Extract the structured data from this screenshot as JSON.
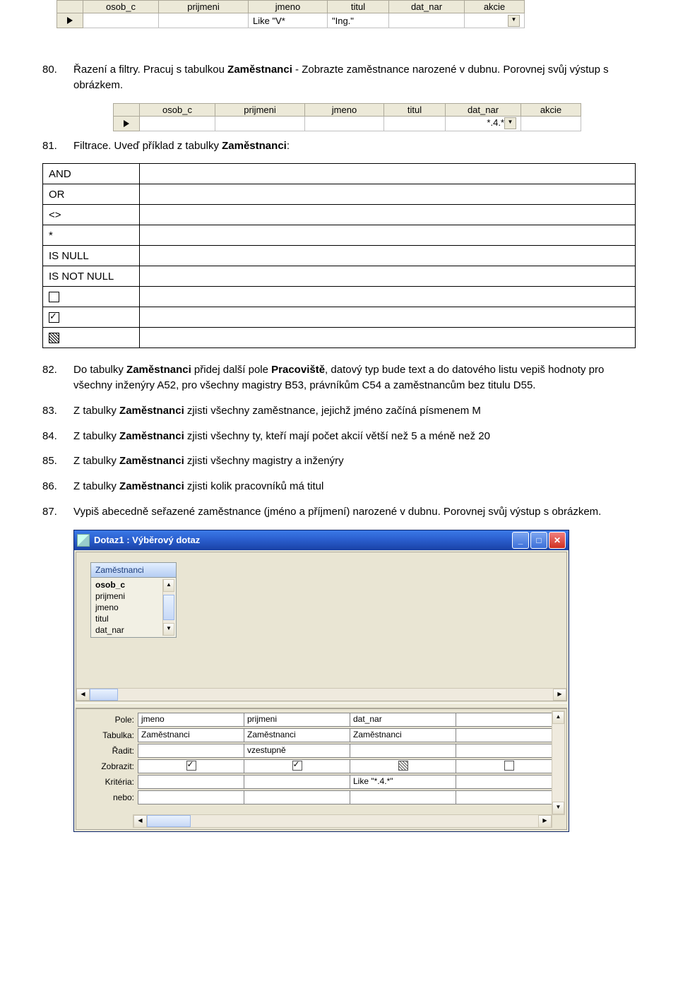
{
  "grid_headers": [
    "osob_c",
    "prijmeni",
    "jmeno",
    "titul",
    "dat_nar",
    "akcie"
  ],
  "grid1_row": [
    "",
    "",
    "Like \"V*",
    "\"Ing.\"",
    "",
    ""
  ],
  "grid2_row": [
    "",
    "",
    "",
    "",
    "*.4.*",
    ""
  ],
  "tasks": {
    "t80_num": "80.",
    "t80_a": "Řazení a filtry. Pracuj s tabulkou ",
    "t80_b": "Zaměstnanci",
    "t80_c": " - Zobrazte zaměstnance narozené v dubnu. Porovnej svůj výstup s obrázkem.",
    "t81_num": "81.",
    "t81_a": "Filtrace. Uveď příklad z tabulky ",
    "t81_b": "Zaměstnanci",
    "t81_c": ":",
    "t82_num": "82.",
    "t82_a": "Do tabulky ",
    "t82_b": "Zaměstnanci",
    "t82_c": " přidej další pole ",
    "t82_d": "Pracoviště",
    "t82_e": ", datový typ bude text a do datového listu vepiš hodnoty pro všechny inženýry A52, pro všechny magistry B53, právníkům C54 a zaměstnancům bez titulu D55.",
    "t83_num": "83.",
    "t83_a": "Z tabulky ",
    "t83_b": "Zaměstnanci",
    "t83_c": " zjisti všechny zaměstnance, jejichž jméno začíná písmenem M",
    "t84_num": "84.",
    "t84_a": "Z tabulky ",
    "t84_b": "Zaměstnanci",
    "t84_c": " zjisti všechny ty, kteří mají počet akcií větší než 5 a méně než 20",
    "t85_num": "85.",
    "t85_a": "Z tabulky ",
    "t85_b": "Zaměstnanci",
    "t85_c": " zjisti všechny magistry a inženýry",
    "t86_num": "86.",
    "t86_a": "Z tabulky ",
    "t86_b": "Zaměstnanci",
    "t86_c": " zjisti kolik pracovníků má titul",
    "t87_num": "87.",
    "t87_a": "Vypiš abecedně seřazené zaměstnance (jméno a příjmení) narozené v dubnu. Porovnej svůj výstup s obrázkem."
  },
  "filters": [
    "AND",
    "OR",
    "<>",
    "*",
    "IS NULL",
    "IS NOT NULL"
  ],
  "win": {
    "title": "Dotaz1 : Výběrový dotaz",
    "table_name": "Zaměstnanci",
    "fields": [
      "osob_c",
      "prijmeni",
      "jmeno",
      "titul",
      "dat_nar"
    ],
    "labels": {
      "pole": "Pole:",
      "tabulka": "Tabulka:",
      "radit": "Řadit:",
      "zobrazit": "Zobrazit:",
      "kriteria": "Kritéria:",
      "nebo": "nebo:"
    },
    "cols": {
      "c1": {
        "pole": "jmeno",
        "tabulka": "Zaměstnanci",
        "radit": "",
        "krit": ""
      },
      "c2": {
        "pole": "prijmeni",
        "tabulka": "Zaměstnanci",
        "radit": "vzestupně",
        "krit": ""
      },
      "c3": {
        "pole": "dat_nar",
        "tabulka": "Zaměstnanci",
        "radit": "",
        "krit": "Like \"*.4.*\""
      },
      "c4": {
        "pole": "",
        "tabulka": "",
        "radit": "",
        "krit": ""
      }
    }
  }
}
